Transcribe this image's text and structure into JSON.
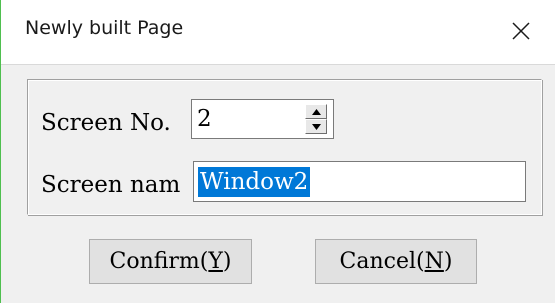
{
  "dialog": {
    "title": "Newly built Page",
    "close_icon": "close-icon"
  },
  "form": {
    "screen_no_label": "Screen No.",
    "screen_no_value": "2",
    "screen_name_label": "Screen nam",
    "screen_name_value": "Window2"
  },
  "buttons": {
    "confirm_text": "Confirm(",
    "confirm_key": "Y",
    "cancel_text": "Cancel(",
    "cancel_key": "N",
    "close_paren": ")"
  },
  "colors": {
    "selection": "#0078d7",
    "accent_edge": "#4fbf4f"
  }
}
